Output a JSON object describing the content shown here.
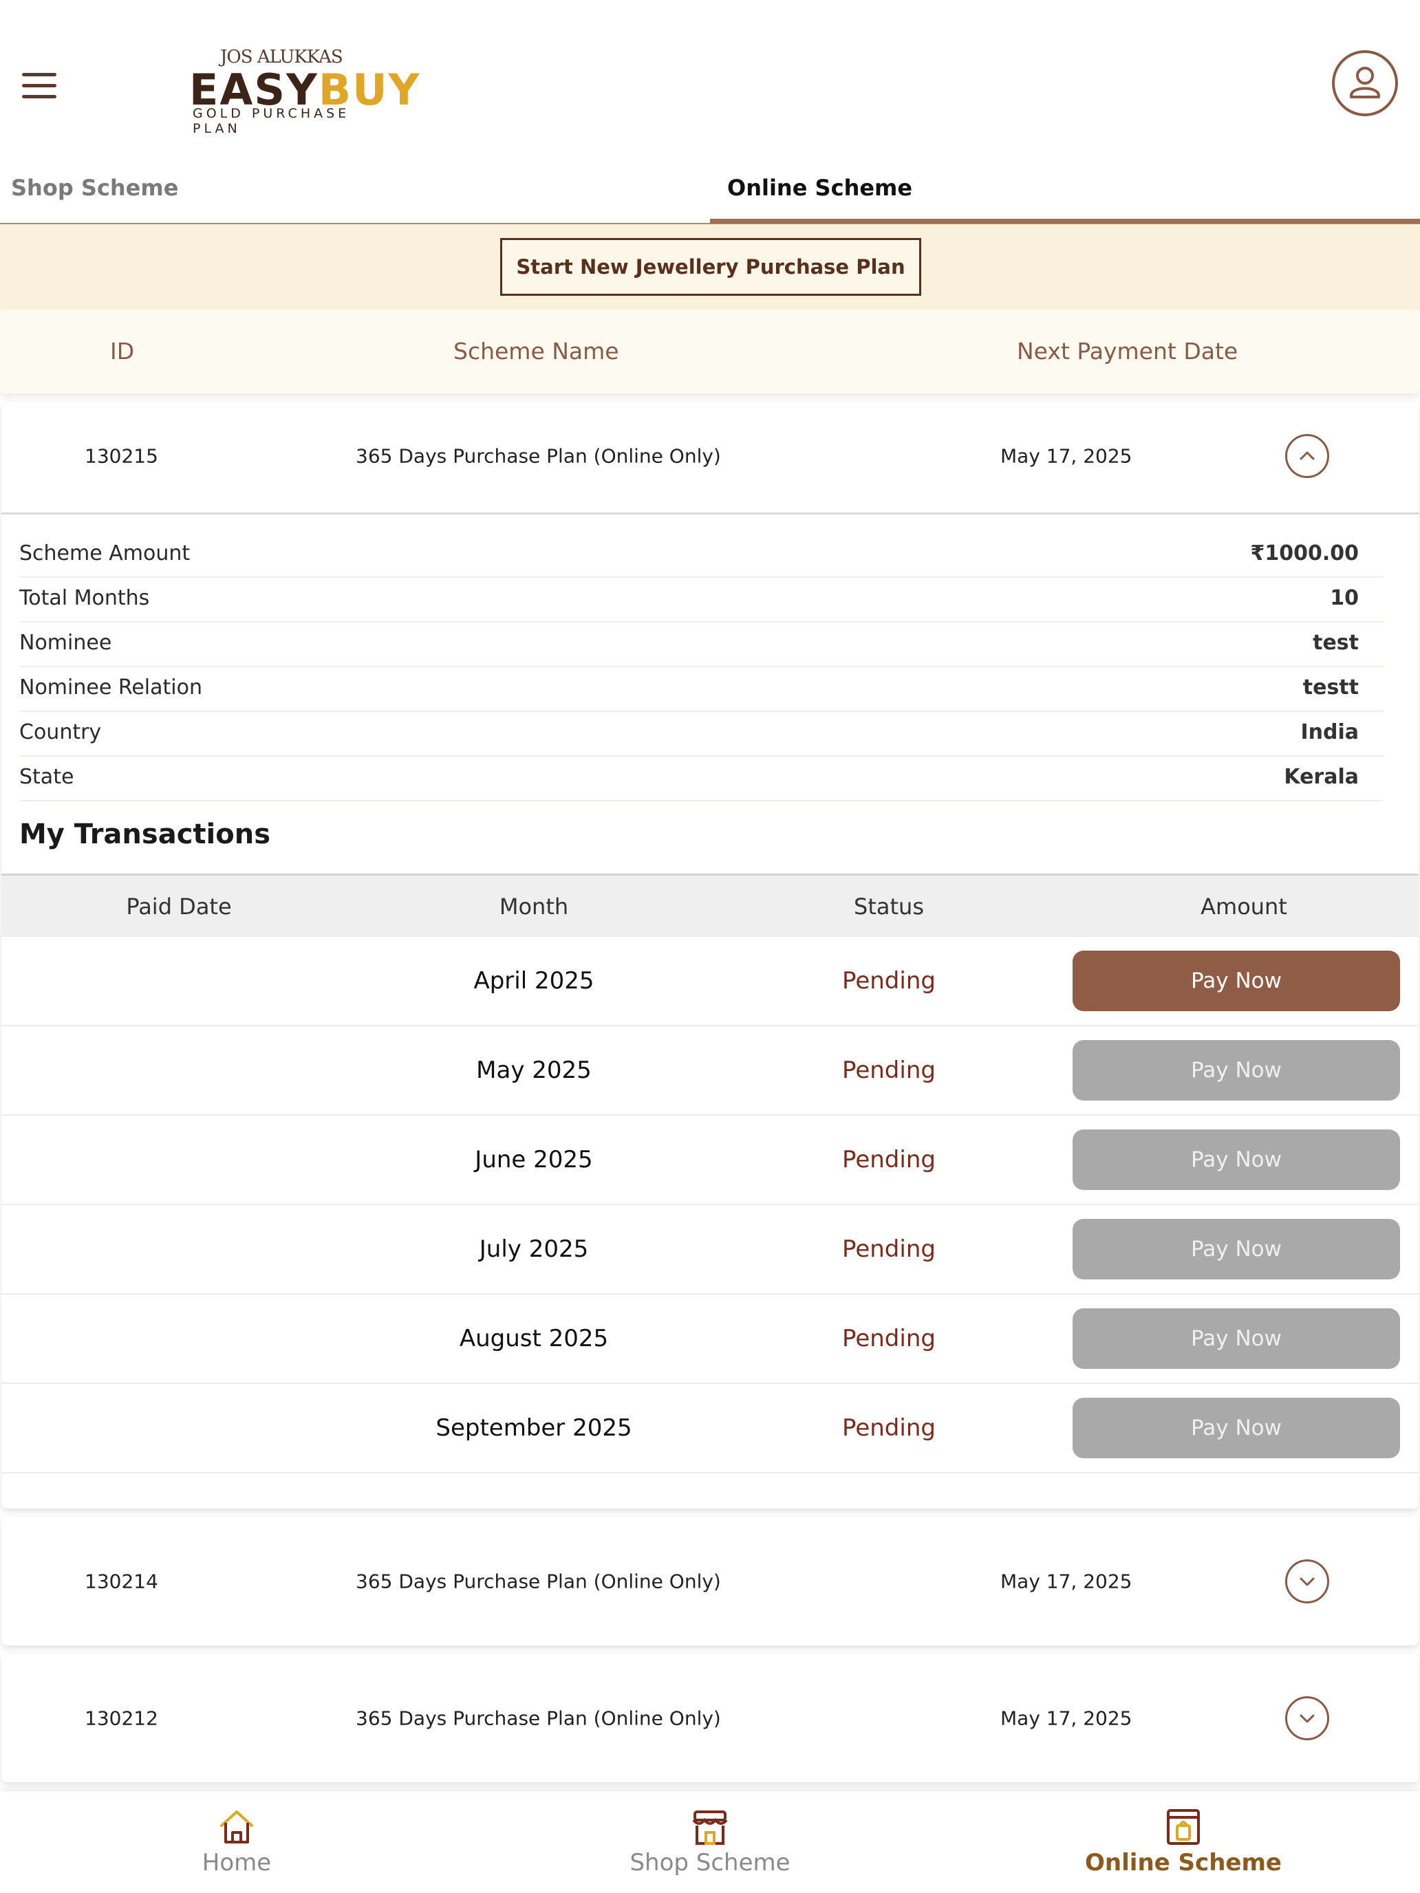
{
  "header": {
    "brand_top": "JOS ALUKKAS",
    "brand_easy": "EASY",
    "brand_buy": "BUY",
    "brand_sub": "GOLD PURCHASE PLAN"
  },
  "tabs": [
    {
      "label": "Shop Scheme",
      "active": false
    },
    {
      "label": "Online Scheme",
      "active": true
    }
  ],
  "banner": {
    "new_plan_button": "Start New Jewellery Purchase Plan"
  },
  "list_header": {
    "id": "ID",
    "scheme_name": "Scheme Name",
    "next_payment_date": "Next Payment Date"
  },
  "schemes": [
    {
      "id": "130215",
      "name": "365 Days Purchase Plan (Online Only)",
      "next_payment_date": "May 17, 2025",
      "expanded": true,
      "details": [
        {
          "label": "Scheme Amount",
          "value": "₹1000.00"
        },
        {
          "label": "Total Months",
          "value": "10"
        },
        {
          "label": "Nominee",
          "value": "test"
        },
        {
          "label": "Nominee Relation",
          "value": "testt"
        },
        {
          "label": "Country",
          "value": "India"
        },
        {
          "label": "State",
          "value": "Kerala"
        }
      ],
      "transactions_title": "My Transactions",
      "transactions_headers": [
        "Paid Date",
        "Month",
        "Status",
        "Amount"
      ],
      "transactions": [
        {
          "paid_date": "",
          "month": "April 2025",
          "status": "Pending",
          "action": "Pay Now",
          "enabled": true
        },
        {
          "paid_date": "",
          "month": "May 2025",
          "status": "Pending",
          "action": "Pay Now",
          "enabled": false
        },
        {
          "paid_date": "",
          "month": "June 2025",
          "status": "Pending",
          "action": "Pay Now",
          "enabled": false
        },
        {
          "paid_date": "",
          "month": "July 2025",
          "status": "Pending",
          "action": "Pay Now",
          "enabled": false
        },
        {
          "paid_date": "",
          "month": "August 2025",
          "status": "Pending",
          "action": "Pay Now",
          "enabled": false
        },
        {
          "paid_date": "",
          "month": "September 2025",
          "status": "Pending",
          "action": "Pay Now",
          "enabled": false
        }
      ]
    },
    {
      "id": "130214",
      "name": "365 Days Purchase Plan (Online Only)",
      "next_payment_date": "May 17, 2025",
      "expanded": false
    },
    {
      "id": "130212",
      "name": "365 Days Purchase Plan (Online Only)",
      "next_payment_date": "May 17, 2025",
      "expanded": false
    }
  ],
  "bottom_nav": [
    {
      "label": "Home",
      "icon": "home-icon",
      "active": false
    },
    {
      "label": "Shop Scheme",
      "icon": "store-icon",
      "active": false
    },
    {
      "label": "Online Scheme",
      "icon": "online-shop-icon",
      "active": true
    }
  ],
  "colors": {
    "brand_brown": "#8b5a44",
    "accent_gold": "#e0a628",
    "banner_bg": "#faf1dd",
    "pay_active": "#8f5c46",
    "pay_disabled": "#a9a9a9",
    "status_pending": "#7a2c1c"
  }
}
